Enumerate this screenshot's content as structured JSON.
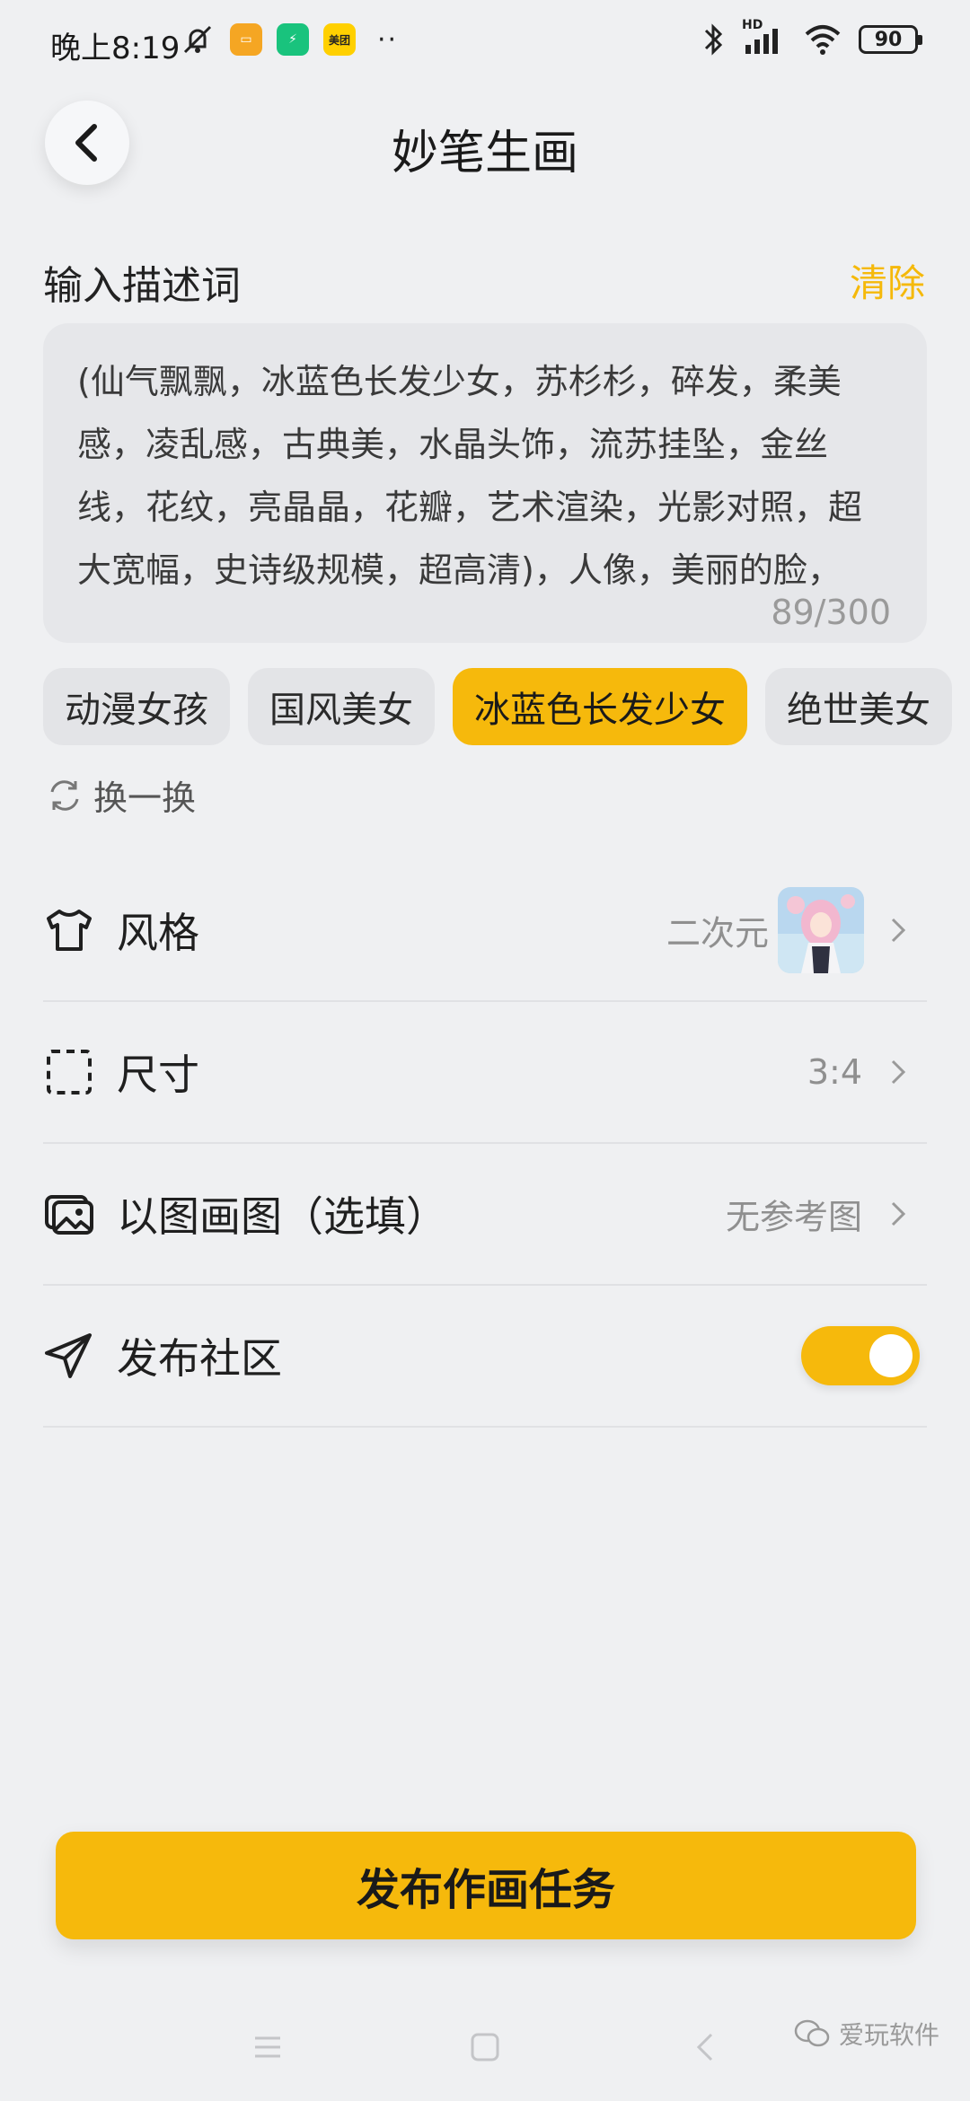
{
  "status_bar": {
    "time": "晚上8:19",
    "app_badge_meituan": "美团",
    "overflow_dots": "··",
    "network_label": "HD",
    "battery": "90"
  },
  "header": {
    "title": "妙笔生画"
  },
  "prompt": {
    "label": "输入描述词",
    "clear_label": "清除",
    "text": "(仙气飘飘，冰蓝色长发少女，苏杉杉，碎发，柔美感，凌乱感，古典美，水晶头饰，流苏挂坠，金丝线，花纹，亮晶晶，花瓣，艺术渲染，光影对照，超大宽幅，史诗级规模，超高清)，人像，美丽的脸，",
    "count": "89/300"
  },
  "suggestions": {
    "chips": [
      {
        "label": "动漫女孩",
        "selected": false
      },
      {
        "label": "国风美女",
        "selected": false
      },
      {
        "label": "冰蓝色长发少女",
        "selected": true
      },
      {
        "label": "绝世美女",
        "selected": false
      }
    ],
    "refresh_label": "换一换"
  },
  "settings": {
    "style": {
      "label": "风格",
      "value": "二次元"
    },
    "size": {
      "label": "尺寸",
      "value": "3:4"
    },
    "img2img": {
      "label": "以图画图（选填）",
      "value": "无参考图"
    },
    "publish": {
      "label": "发布社区",
      "enabled": true
    }
  },
  "submit": {
    "label": "发布作画任务"
  },
  "watermark": {
    "text": "爱玩软件"
  },
  "colors": {
    "accent": "#f6b90c",
    "background": "#eff0f2"
  }
}
